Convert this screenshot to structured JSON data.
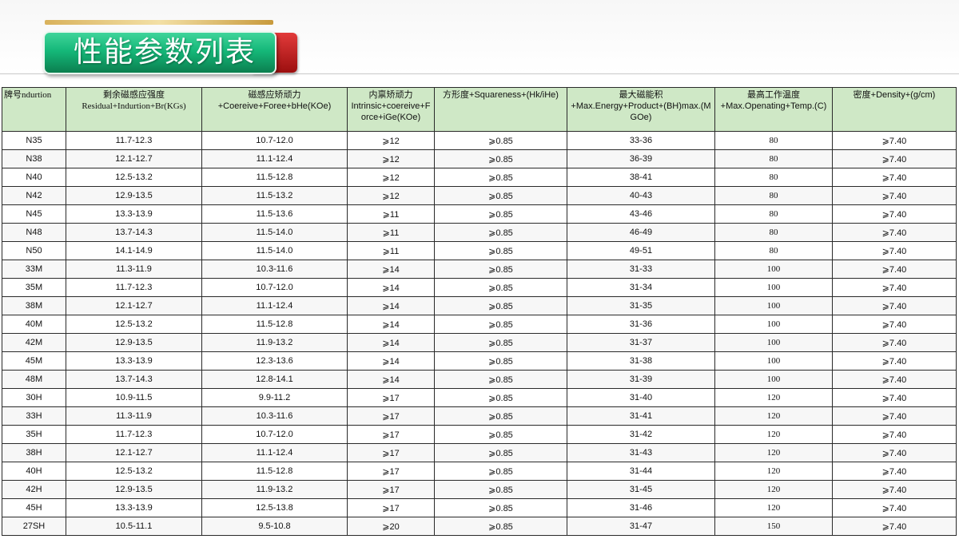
{
  "slide": {
    "title": "性能参数列表"
  },
  "table": {
    "headers": [
      {
        "line1": "牌号",
        "line2": "ndurtion"
      },
      {
        "line1": "剩余磁感应强度",
        "line2": "Residual+Indurtion+Br(KGs)"
      },
      {
        "line1": "磁感应矫顽力",
        "line2": "+Coereive+Foree+bHe(KOe)"
      },
      {
        "line1": "内禀矫顽力",
        "line2": "Intrinsic+coereive+Force+iGe(KOe)"
      },
      {
        "line1": "方形度+Squareness+(Hk/iHe)",
        "line2": ""
      },
      {
        "line1": "最大磁能积",
        "line2": "+Max.Energy+Product+(BH)max.(MGOe)"
      },
      {
        "line1": "最高工作温度",
        "line2": "+Max.Openating+Temp.(C)"
      },
      {
        "line1": "密度+Density+(g/cm)",
        "line2": ""
      }
    ],
    "rows": [
      [
        "N35",
        "11.7-12.3",
        "10.7-12.0",
        "⩾12",
        "⩾0.85",
        "33-36",
        "80",
        "⩾7.40"
      ],
      [
        "N38",
        "12.1-12.7",
        "11.1-12.4",
        "⩾12",
        "⩾0.85",
        "36-39",
        "80",
        "⩾7.40"
      ],
      [
        "N40",
        "12.5-13.2",
        "11.5-12.8",
        "⩾12",
        "⩾0.85",
        "38-41",
        "80",
        "⩾7.40"
      ],
      [
        "N42",
        "12.9-13.5",
        "11.5-13.2",
        "⩾12",
        "⩾0.85",
        "40-43",
        "80",
        "⩾7.40"
      ],
      [
        "N45",
        "13.3-13.9",
        "11.5-13.6",
        "⩾11",
        "⩾0.85",
        "43-46",
        "80",
        "⩾7.40"
      ],
      [
        "N48",
        "13.7-14.3",
        "11.5-14.0",
        "⩾11",
        "⩾0.85",
        "46-49",
        "80",
        "⩾7.40"
      ],
      [
        "N50",
        "14.1-14.9",
        "11.5-14.0",
        "⩾11",
        "⩾0.85",
        "49-51",
        "80",
        "⩾7.40"
      ],
      [
        "33M",
        "11.3-11.9",
        "10.3-11.6",
        "⩾14",
        "⩾0.85",
        "31-33",
        "100",
        "⩾7.40"
      ],
      [
        "35M",
        "11.7-12.3",
        "10.7-12.0",
        "⩾14",
        "⩾0.85",
        "31-34",
        "100",
        "⩾7.40"
      ],
      [
        "38M",
        "12.1-12.7",
        "11.1-12.4",
        "⩾14",
        "⩾0.85",
        "31-35",
        "100",
        "⩾7.40"
      ],
      [
        "40M",
        "12.5-13.2",
        "11.5-12.8",
        "⩾14",
        "⩾0.85",
        "31-36",
        "100",
        "⩾7.40"
      ],
      [
        "42M",
        "12.9-13.5",
        "11.9-13.2",
        "⩾14",
        "⩾0.85",
        "31-37",
        "100",
        "⩾7.40"
      ],
      [
        "45M",
        "13.3-13.9",
        "12.3-13.6",
        "⩾14",
        "⩾0.85",
        "31-38",
        "100",
        "⩾7.40"
      ],
      [
        "48M",
        "13.7-14.3",
        "12.8-14.1",
        "⩾14",
        "⩾0.85",
        "31-39",
        "100",
        "⩾7.40"
      ],
      [
        "30H",
        "10.9-11.5",
        "9.9-11.2",
        "⩾17",
        "⩾0.85",
        "31-40",
        "120",
        "⩾7.40"
      ],
      [
        "33H",
        "11.3-11.9",
        "10.3-11.6",
        "⩾17",
        "⩾0.85",
        "31-41",
        "120",
        "⩾7.40"
      ],
      [
        "35H",
        "11.7-12.3",
        "10.7-12.0",
        "⩾17",
        "⩾0.85",
        "31-42",
        "120",
        "⩾7.40"
      ],
      [
        "38H",
        "12.1-12.7",
        "11.1-12.4",
        "⩾17",
        "⩾0.85",
        "31-43",
        "120",
        "⩾7.40"
      ],
      [
        "40H",
        "12.5-13.2",
        "11.5-12.8",
        "⩾17",
        "⩾0.85",
        "31-44",
        "120",
        "⩾7.40"
      ],
      [
        "42H",
        "12.9-13.5",
        "11.9-13.2",
        "⩾17",
        "⩾0.85",
        "31-45",
        "120",
        "⩾7.40"
      ],
      [
        "45H",
        "13.3-13.9",
        "12.5-13.8",
        "⩾17",
        "⩾0.85",
        "31-46",
        "120",
        "⩾7.40"
      ],
      [
        "27SH",
        "10.5-11.1",
        "9.5-10.8",
        "⩾20",
        "⩾0.85",
        "31-47",
        "150",
        "⩾7.40"
      ]
    ]
  }
}
